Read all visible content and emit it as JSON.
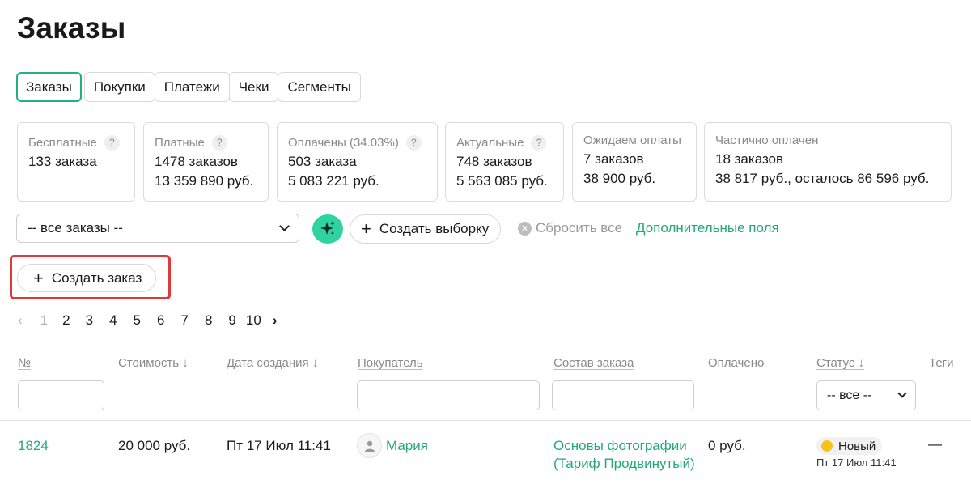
{
  "page": {
    "title": "Заказы"
  },
  "tabs": [
    {
      "label": "Заказы",
      "active": true
    },
    {
      "label": "Покупки"
    },
    {
      "label": "Платежи"
    },
    {
      "label": "Чеки"
    },
    {
      "label": "Сегменты"
    }
  ],
  "stats": [
    {
      "title": "Бесплатные",
      "help": "?",
      "line1": "133 заказа",
      "line2": ""
    },
    {
      "title": "Платные",
      "help": "?",
      "line1": "1478 заказов",
      "line2": "13 359 890 руб."
    },
    {
      "title": "Оплачены (34.03%)",
      "help": "?",
      "line1": "503 заказа",
      "line2": "5 083 221 руб."
    },
    {
      "title": "Актуальные",
      "help": "?",
      "line1": "748 заказов",
      "line2": "5 563 085 руб."
    },
    {
      "title": "Ожидаем оплаты",
      "line1": "7 заказов",
      "line2": "38 900 руб."
    },
    {
      "title": "Частично оплачен",
      "line1": "18 заказов",
      "line2": "38 817 руб., осталось 86 596 руб."
    }
  ],
  "toolbar": {
    "filter_value": "-- все заказы --",
    "create_selection": "Создать выборку",
    "reset_all": "Сбросить все",
    "extra_fields": "Дополнительные поля",
    "create_order": "Создать заказ",
    "accent_color": "#23a876",
    "ai_color": "#2fd3a0"
  },
  "pagination": {
    "prev": "‹",
    "pages": [
      "1",
      "2",
      "3",
      "4",
      "5",
      "6",
      "7",
      "8",
      "9",
      "10"
    ],
    "current": "1",
    "next": "›"
  },
  "table": {
    "headers": {
      "num": "№",
      "cost": "Стоимость ↓",
      "created": "Дата создания ↓",
      "buyer": "Покупатель",
      "contents": "Состав заказа",
      "paid": "Оплачено",
      "status": "Статус ↓",
      "tags": "Теги"
    },
    "status_filter": "-- все --",
    "rows": [
      {
        "num": "1824",
        "cost": "20 000 руб.",
        "created": "Пт 17 Июл 11:41",
        "buyer": "Мария",
        "contents": "Основы фотографии (Тариф Продвинутый)",
        "paid": "0 руб.",
        "status": "Новый",
        "status_color": "#f7c21a",
        "status_date": "Пт 17 Июл 11:41",
        "tags": "—"
      }
    ]
  }
}
